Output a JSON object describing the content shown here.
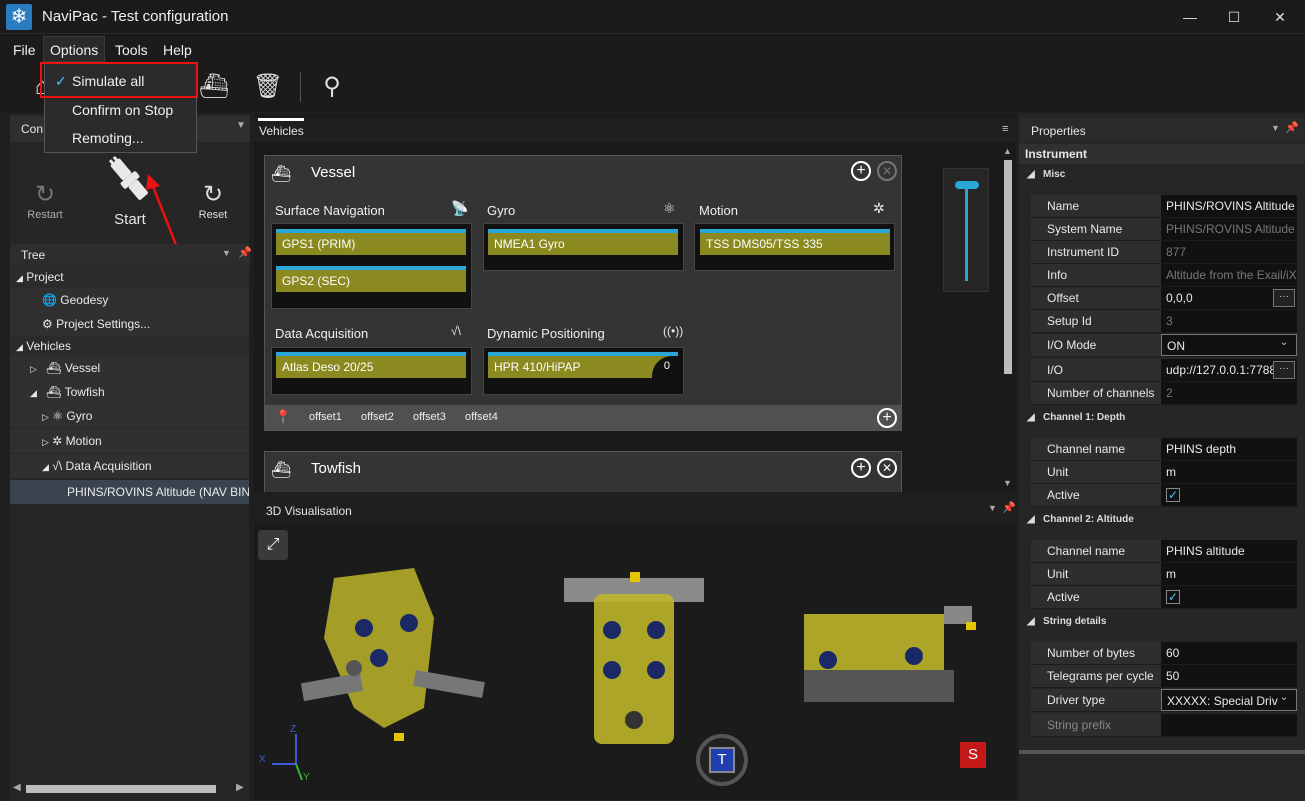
{
  "window": {
    "title": "NaviPac  - Test configuration",
    "logo": "snowflake-icon"
  },
  "menubar": {
    "items": [
      "File",
      "Options",
      "Tools",
      "Help"
    ]
  },
  "options_menu": {
    "items": [
      {
        "label": "Simulate all",
        "checked": true
      },
      {
        "label": "Confirm on Stop",
        "checked": false
      },
      {
        "label": "Remoting...",
        "checked": false
      }
    ]
  },
  "left_panel": {
    "connection_header": "Con",
    "controls": {
      "restart": "Restart",
      "start": "Start",
      "reset": "Reset"
    },
    "tree_header": "Tree",
    "tree": [
      {
        "label": "Project",
        "level": 0
      },
      {
        "label": "Geodesy",
        "level": 1
      },
      {
        "label": "Project Settings...",
        "level": 1
      },
      {
        "label": "Vehicles",
        "level": 0
      },
      {
        "label": "Vessel",
        "level": 1
      },
      {
        "label": "Towfish",
        "level": 1
      },
      {
        "label": "Gyro",
        "level": 2
      },
      {
        "label": "Motion",
        "level": 2
      },
      {
        "label": "Data Acquisition",
        "level": 2
      },
      {
        "label": "PHINS/ROVINS Altitude (NAV BINA",
        "level": 3
      }
    ]
  },
  "vehicles_panel": {
    "tab": "Vehicles",
    "vessel": {
      "title": "Vessel",
      "groups": {
        "surface_navigation": {
          "title": "Surface Navigation",
          "items": [
            "GPS1 (PRIM)",
            "GPS2 (SEC)"
          ]
        },
        "gyro": {
          "title": "Gyro",
          "items": [
            "NMEA1 Gyro"
          ]
        },
        "motion": {
          "title": "Motion",
          "items": [
            "TSS DMS05/TSS 335"
          ]
        },
        "data_acquisition": {
          "title": "Data Acquisition",
          "items": [
            "Atlas Deso 20/25"
          ]
        },
        "dynamic_positioning": {
          "title": "Dynamic Positioning",
          "items": [
            "HPR 410/HiPAP"
          ],
          "badge": "0"
        }
      },
      "offsets": [
        "offset1",
        "offset2",
        "offset3",
        "offset4"
      ]
    },
    "towfish": {
      "title": "Towfish"
    }
  },
  "visualisation": {
    "title": "3D Visualisation",
    "badge_top": "T",
    "badge_side": "S",
    "axes": [
      "Z",
      "X",
      "Y"
    ]
  },
  "properties": {
    "title": "Properties",
    "category": "Instrument",
    "sections": [
      {
        "name": "Misc",
        "rows": [
          {
            "name": "Name",
            "value": "PHINS/ROVINS Altitude"
          },
          {
            "name": "System Name",
            "value": "PHINS/ROVINS Altitude (",
            "dim": true
          },
          {
            "name": "Instrument ID",
            "value": "877",
            "dim": true
          },
          {
            "name": "Info",
            "value": "Altitude from the Exail/iX",
            "dim": true
          },
          {
            "name": "Offset",
            "value": "0,0,0"
          },
          {
            "name": "Setup Id",
            "value": "3",
            "dim": true
          },
          {
            "name": "I/O Mode",
            "value": "ON"
          },
          {
            "name": "I/O",
            "value": "udp://127.0.0.1:7788"
          },
          {
            "name": "Number of channels",
            "value": "2",
            "dim": true
          }
        ]
      },
      {
        "name": "Channel 1: Depth",
        "rows": [
          {
            "name": "Channel name",
            "value": "PHINS depth"
          },
          {
            "name": "Unit",
            "value": "m"
          },
          {
            "name": "Active",
            "value": "✓"
          }
        ]
      },
      {
        "name": "Channel 2: Altitude",
        "rows": [
          {
            "name": "Channel name",
            "value": "PHINS altitude"
          },
          {
            "name": "Unit",
            "value": "m"
          },
          {
            "name": "Active",
            "value": "✓"
          }
        ]
      },
      {
        "name": "String details",
        "rows": [
          {
            "name": "Number of bytes",
            "value": "60"
          },
          {
            "name": "Telegrams per cycle",
            "value": "50"
          },
          {
            "name": "Driver type",
            "value": "XXXXX:   Special Driv"
          },
          {
            "name": "String prefix",
            "value": ""
          }
        ]
      }
    ]
  },
  "colors": {
    "instrument_fill": "#8a8a20",
    "instrument_bar": "#2aa7d6",
    "highlight": "#e11111",
    "accent": "#2a7bbf"
  }
}
